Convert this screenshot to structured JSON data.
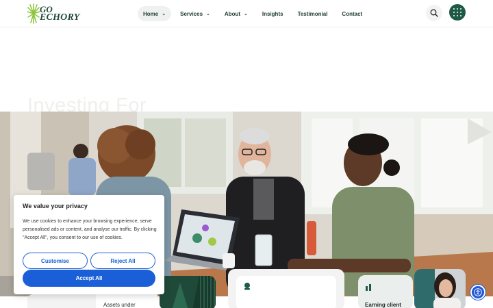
{
  "header": {
    "logo_line1": "GO",
    "logo_line2": "ECHORY",
    "logo_icon": "sunburst-logo-icon",
    "nav": [
      {
        "label": "Home",
        "has_dropdown": true,
        "active": true
      },
      {
        "label": "Services",
        "has_dropdown": true,
        "active": false
      },
      {
        "label": "About",
        "has_dropdown": true,
        "active": false
      },
      {
        "label": "Insights",
        "has_dropdown": false,
        "active": false
      },
      {
        "label": "Testimonial",
        "has_dropdown": false,
        "active": false
      },
      {
        "label": "Contact",
        "has_dropdown": false,
        "active": false
      }
    ],
    "search_icon": "search-icon",
    "menu_icon": "grid-menu-icon"
  },
  "hero": {
    "title": "Investing For"
  },
  "cards": {
    "assets_label": "Assets under",
    "earning_label": "Earning client",
    "center_icon": "leaf-icon",
    "earning_icon": "bar-chart-icon"
  },
  "cookie": {
    "title": "We value your privacy",
    "body": "We use cookies to enhance your browsing experience, serve personalised ads or content, and analyse our traffic. By clicking \"Accept All\", you consent to our use of cookies.",
    "customise_label": "Customise",
    "reject_label": "Reject All",
    "accept_label": "Accept All"
  },
  "accessibility_icon": "accessibility-icon",
  "colors": {
    "brand_green": "#1e5a45",
    "cookie_blue": "#1a5fd7",
    "a11y_blue": "#2158d6"
  }
}
